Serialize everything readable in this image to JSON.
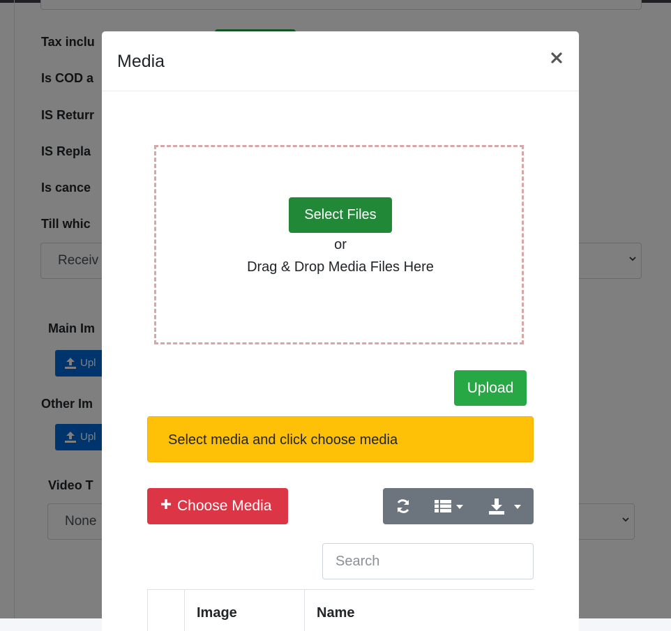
{
  "background": {
    "labels": [
      "Tax inclu",
      "Is COD a",
      "IS Returr",
      "IS Repla",
      "Is cance",
      "Till whic",
      "Main Im",
      "Other Im",
      "Video T"
    ],
    "till_select_value": "Receiv",
    "main_upload_label": "Upl",
    "other_upload_label": "Upl",
    "video_select_value": "None"
  },
  "modal": {
    "title": "Media",
    "select_files_label": "Select Files",
    "or_text": "or",
    "drag_drop_text": "Drag & Drop Media Files Here",
    "upload_label": "Upload",
    "alert_text": "Select media and click choose media",
    "choose_media_label": "Choose Media",
    "search_placeholder": "Search",
    "table_headers": [
      "",
      "Image",
      "Name"
    ]
  },
  "colors": {
    "success": "#28a745",
    "danger": "#dc3545",
    "warning": "#ffc107",
    "secondary": "#6c757d",
    "primary": "#0069d9"
  },
  "icons": [
    "close-icon",
    "upload-icon",
    "plus-icon",
    "refresh-icon",
    "list-icon",
    "caret-down-icon",
    "download-icon",
    "chevron-down-icon"
  ]
}
